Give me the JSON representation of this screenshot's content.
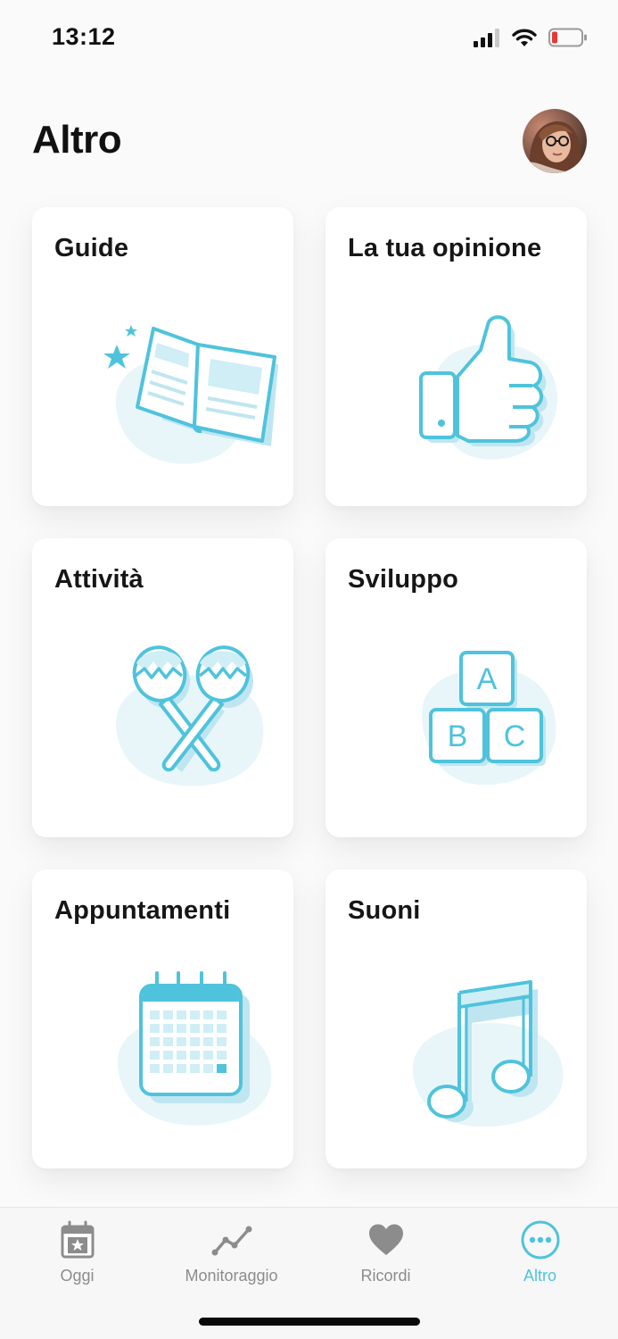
{
  "status_bar": {
    "time": "13:12",
    "icons": [
      "cellular-signal-icon",
      "wifi-icon",
      "battery-low-icon"
    ]
  },
  "header": {
    "title": "Altro",
    "avatar": "profile-avatar"
  },
  "cards": [
    {
      "id": "guide",
      "title": "Guide",
      "icon": "open-book-icon"
    },
    {
      "id": "opinion",
      "title": "La tua opinione",
      "icon": "thumbs-up-icon"
    },
    {
      "id": "activities",
      "title": "Attività",
      "icon": "maracas-icon"
    },
    {
      "id": "development",
      "title": "Sviluppo",
      "icon": "abc-blocks-icon",
      "block_letters": [
        "A",
        "B",
        "C"
      ]
    },
    {
      "id": "appointments",
      "title": "Appuntamenti",
      "icon": "calendar-icon"
    },
    {
      "id": "sounds",
      "title": "Suoni",
      "icon": "music-note-icon"
    }
  ],
  "tab_bar": {
    "tabs": [
      {
        "label": "Oggi",
        "icon": "calendar-star-icon",
        "active": false
      },
      {
        "label": "Monitoraggio",
        "icon": "line-chart-icon",
        "active": false
      },
      {
        "label": "Ricordi",
        "icon": "heart-icon",
        "active": false
      },
      {
        "label": "Altro",
        "icon": "more-dots-icon",
        "active": true
      }
    ]
  },
  "colors": {
    "accent": "#4fc3dc",
    "accent_light": "#e8f6fa",
    "inactive": "#8c8c8c",
    "battery_low": "#e53935"
  }
}
